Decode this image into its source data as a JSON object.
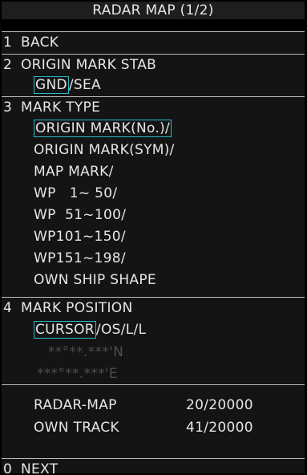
{
  "title": "RADAR MAP (1/2)",
  "back": {
    "num": "1",
    "label": "BACK"
  },
  "origin_stab": {
    "num": "2",
    "label": "ORIGIN MARK STAB",
    "options": [
      "GND",
      "SEA"
    ],
    "selected": "GND",
    "sep": "/"
  },
  "mark_type": {
    "num": "3",
    "label": "MARK TYPE",
    "items": [
      "ORIGIN MARK(No.)/",
      "ORIGIN MARK(SYM)/",
      "MAP MARK/",
      "WP   1~ 50/",
      "WP  51~100/",
      "WP101~150/",
      "WP151~198/",
      "OWN SHIP SHAPE"
    ],
    "selected_index": 0
  },
  "mark_position": {
    "num": "4",
    "label": "MARK POSITION",
    "options": [
      "CURSOR",
      "OS/L/L"
    ],
    "selected": "CURSOR",
    "sep": "/",
    "lat": "**°**.***'N",
    "lon": "***°**.***'E"
  },
  "stats": [
    {
      "label": "RADAR-MAP",
      "value": "20/20000"
    },
    {
      "label": "OWN TRACK",
      "value": "41/20000"
    }
  ],
  "next": {
    "num": "0",
    "label": "NEXT"
  },
  "colors": {
    "select_border": "#2bb8c9",
    "text": "#e6e6e6",
    "dim_text": "#4d4d4d",
    "bg": "#141414",
    "title_bg": "#1e1e1e"
  }
}
